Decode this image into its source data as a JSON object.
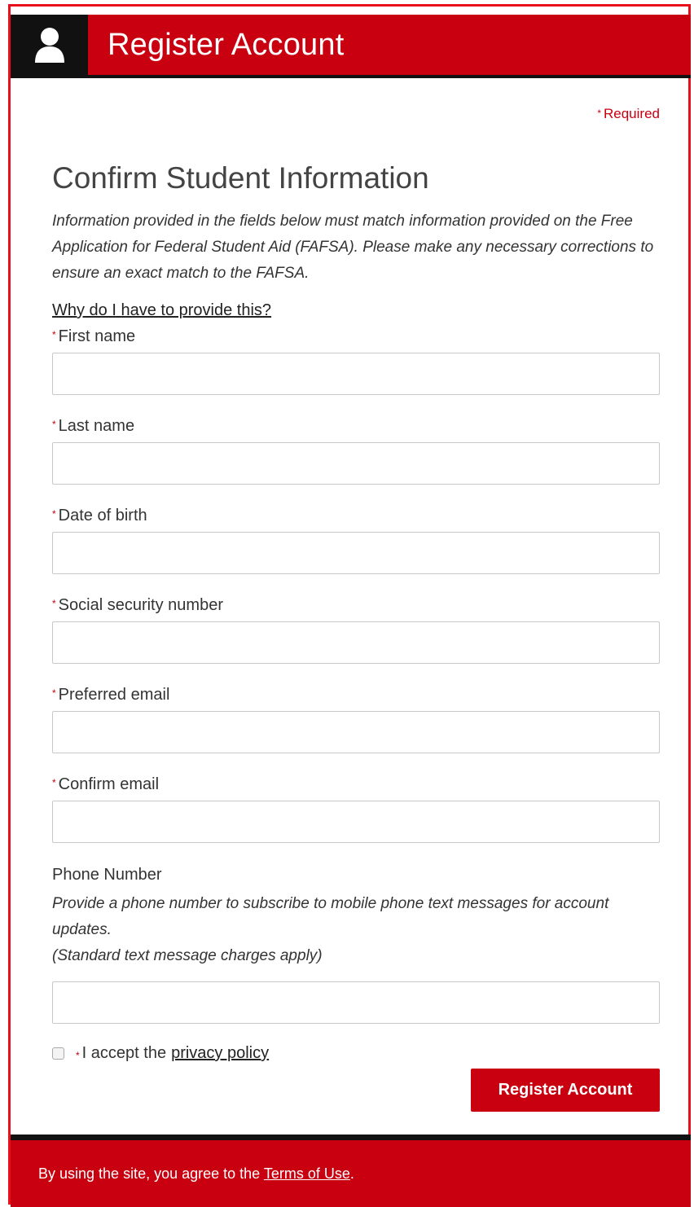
{
  "header": {
    "title": "Register Account",
    "icon": "user-icon"
  },
  "required_note": "Required",
  "section_title": "Confirm Student Information",
  "intro": "Information provided in the fields below must match information provided on the Free Application for Federal Student Aid (FAFSA). Please make any necessary corrections to ensure an exact match to the FAFSA.",
  "why_link": "Why do I have to provide this?",
  "fields": {
    "first_name": {
      "label": "First name",
      "value": ""
    },
    "last_name": {
      "label": "Last name",
      "value": ""
    },
    "dob": {
      "label": "Date of birth",
      "value": ""
    },
    "ssn": {
      "label": "Social security number",
      "value": ""
    },
    "email": {
      "label": "Preferred email",
      "value": ""
    },
    "confirm_email": {
      "label": "Confirm email",
      "value": ""
    },
    "phone": {
      "label": "Phone Number",
      "value": ""
    }
  },
  "phone_note_line1": "Provide a phone number to subscribe to mobile phone text messages for account updates.",
  "phone_note_line2": "(Standard text message charges apply)",
  "privacy": {
    "prefix": "I accept the",
    "link": "privacy policy",
    "checked": false
  },
  "register_button": "Register Account",
  "footer": {
    "prefix": "By using the site, you agree to the",
    "link": "Terms of Use",
    "suffix": "."
  },
  "colors": {
    "brand_red": "#c8000f",
    "header_black": "#111111"
  }
}
